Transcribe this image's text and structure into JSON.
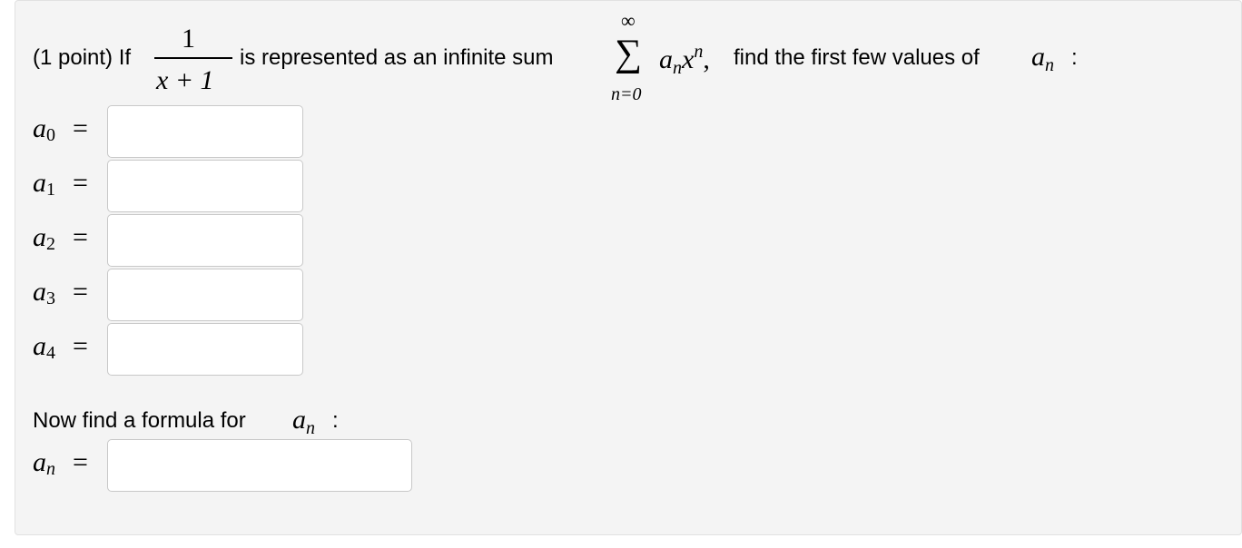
{
  "problem": {
    "prefix": "(1 point) If",
    "frac_num": "1",
    "frac_den": "x + 1",
    "middle": "is represented as an infinite sum",
    "sum_upper": "∞",
    "sum_symbol": "∑",
    "sum_lower": "n=0",
    "term_base": "a",
    "term_sub": "n",
    "term_x": "x",
    "term_sup": "n",
    "comma": ",",
    "suffix": "find the first few values of",
    "an_base": "a",
    "an_sub": "n",
    "colon": ":"
  },
  "answers": [
    {
      "base": "a",
      "sub": "0",
      "eq": "=",
      "value": ""
    },
    {
      "base": "a",
      "sub": "1",
      "eq": "=",
      "value": ""
    },
    {
      "base": "a",
      "sub": "2",
      "eq": "=",
      "value": ""
    },
    {
      "base": "a",
      "sub": "3",
      "eq": "=",
      "value": ""
    },
    {
      "base": "a",
      "sub": "4",
      "eq": "=",
      "value": ""
    }
  ],
  "formula": {
    "prompt": "Now find a formula for",
    "an_base": "a",
    "an_sub": "n",
    "colon": ":",
    "label_base": "a",
    "label_sub": "n",
    "eq": "=",
    "value": ""
  }
}
